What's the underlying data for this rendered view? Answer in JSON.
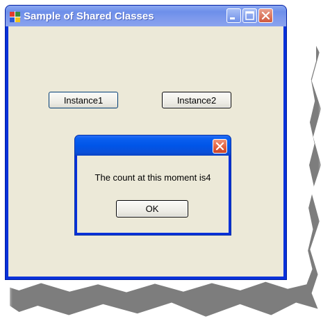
{
  "window": {
    "title": "Sample of Shared Classes"
  },
  "buttons": {
    "instance1": "Instance1",
    "instance2": "Instance2"
  },
  "dialog": {
    "message": "The count at this moment is4",
    "ok_label": "OK"
  }
}
